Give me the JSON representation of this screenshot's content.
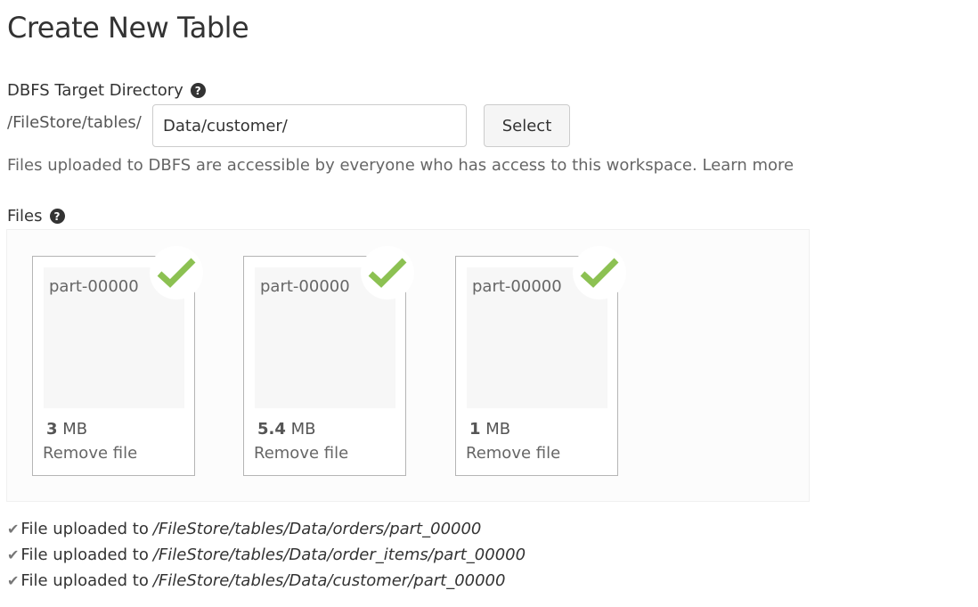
{
  "page": {
    "title": "Create New Table"
  },
  "target_directory": {
    "label": "DBFS Target Directory",
    "help_icon": "question-circle-icon",
    "prefix": "/FileStore/tables/",
    "input_value": "Data/customer/",
    "select_label": "Select",
    "info_text": "Files uploaded to DBFS are accessible by everyone who has access to this workspace. Learn more"
  },
  "files": {
    "label": "Files",
    "help_icon": "question-circle-icon",
    "check_color": "#8cc152",
    "cards": [
      {
        "name": "part-00000",
        "size_value": "3",
        "size_unit": "MB",
        "remove_label": "Remove file",
        "status_icon": "check-icon"
      },
      {
        "name": "part-00000",
        "size_value": "5.4",
        "size_unit": "MB",
        "remove_label": "Remove file",
        "status_icon": "check-icon"
      },
      {
        "name": "part-00000",
        "size_value": "1",
        "size_unit": "MB",
        "remove_label": "Remove file",
        "status_icon": "check-icon"
      }
    ]
  },
  "uploads": [
    {
      "text": "File uploaded to",
      "path": "/FileStore/tables/Data/orders/part_00000",
      "icon": "check-icon"
    },
    {
      "text": "File uploaded to",
      "path": "/FileStore/tables/Data/order_items/part_00000",
      "icon": "check-icon"
    },
    {
      "text": "File uploaded to",
      "path": "/FileStore/tables/Data/customer/part_00000",
      "icon": "check-icon"
    }
  ]
}
